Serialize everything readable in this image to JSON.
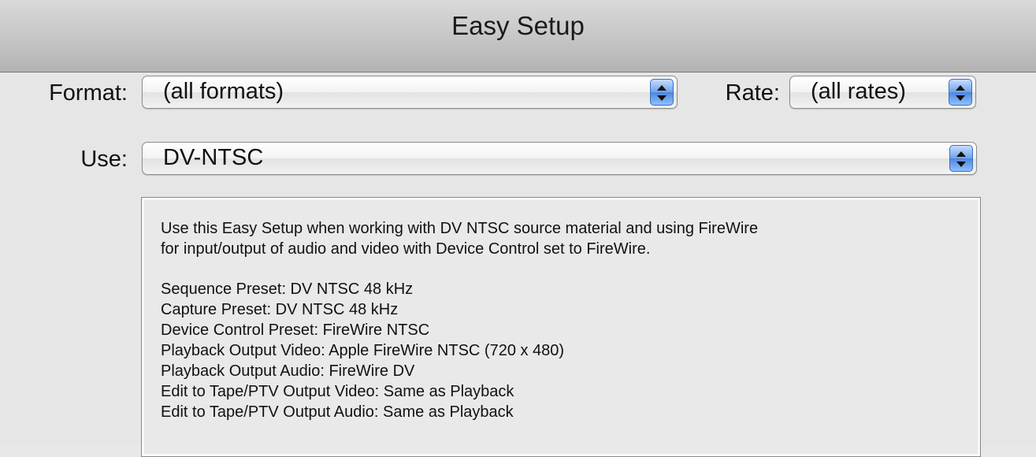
{
  "window": {
    "title": "Easy Setup"
  },
  "form": {
    "format_label": "Format:",
    "format_value": "(all formats)",
    "rate_label": "Rate:",
    "rate_value": "(all rates)",
    "use_label": "Use:",
    "use_value": "DV-NTSC"
  },
  "description": {
    "intro_line1": "Use this Easy Setup when working with DV NTSC source material and using FireWire",
    "intro_line2": "for input/output of audio and video with Device Control set to FireWire.",
    "lines": [
      "Sequence Preset: DV NTSC 48 kHz",
      "Capture Preset: DV NTSC 48 kHz",
      "Device Control Preset: FireWire NTSC",
      "Playback Output Video: Apple FireWire NTSC (720 x 480)",
      "Playback Output Audio: FireWire DV",
      "Edit to Tape/PTV Output Video: Same as Playback",
      "Edit to Tape/PTV Output Audio: Same as Playback"
    ]
  },
  "icons": {
    "popup_arrows": "up-down-arrows-icon"
  },
  "colors": {
    "accent_blue": "#5a8fe0",
    "panel_bg": "#e6e6e6"
  }
}
